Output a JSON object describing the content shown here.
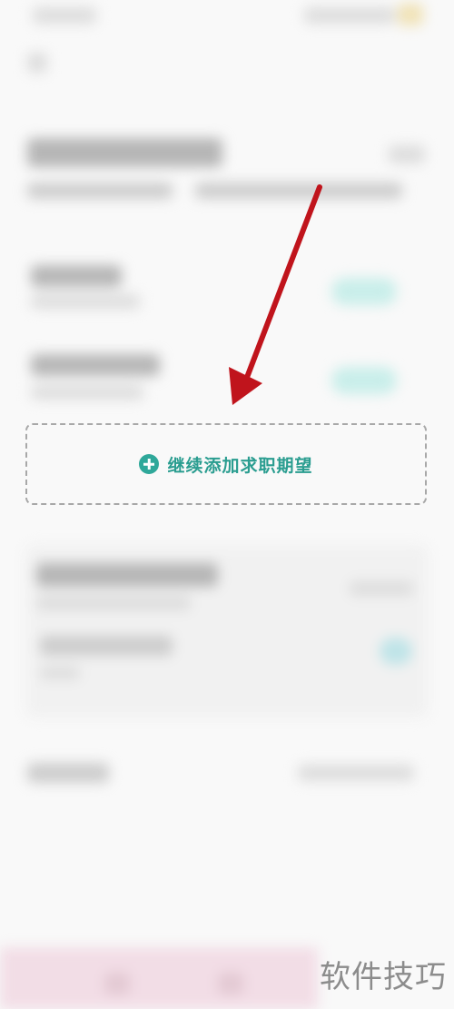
{
  "add_expectation": {
    "label": "继续添加求职期望"
  },
  "watermark": {
    "text": "软件技巧"
  },
  "colors": {
    "accent": "#2fa89a",
    "arrow": "#c0141c",
    "dashed_border": "#a8a8a8"
  },
  "icons": {
    "add": "plus-circle-icon",
    "annotation": "red-arrow"
  }
}
